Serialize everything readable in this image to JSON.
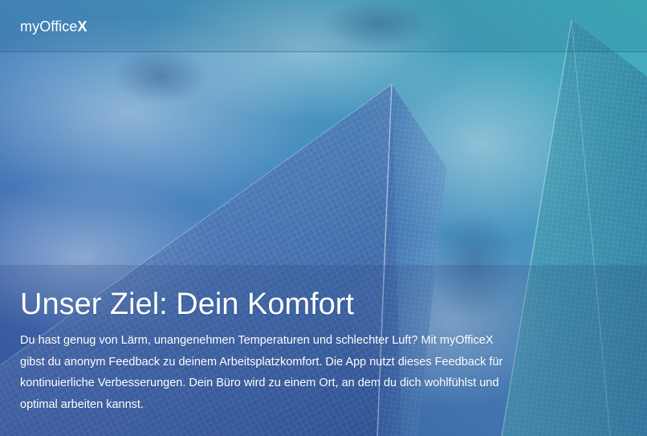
{
  "header": {
    "logo_text": "myOffice",
    "logo_suffix": "X"
  },
  "hero": {
    "headline": "Unser Ziel: Dein Komfort",
    "paragraph": "Du hast genug von Lärm, unangenehmen Temperaturen und schlechter Luft? Mit myOfficeX gibst du anonym Feedback zu deinem Arbeitsplatzkomfort. Die App nutzt dieses Feedback für kontinuierliche Verbesserungen. Dein Büro wird zu einem Ort, an dem du dich wohlfühlst und optimal arbeiten kannst."
  },
  "colors": {
    "overlay_left": "#3f5fb0",
    "overlay_right": "#3aa7b4",
    "text": "#ffffff"
  }
}
